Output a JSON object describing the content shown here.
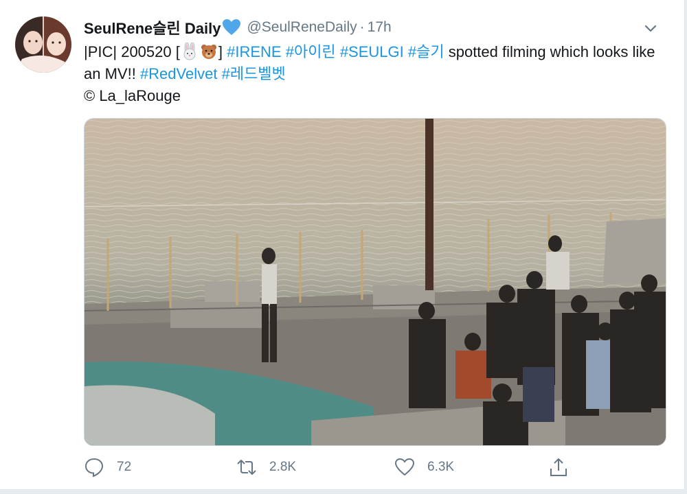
{
  "tweet": {
    "display_name": "SeulRene슬린 Daily",
    "handle": "@SeulReneDaily",
    "separator": "·",
    "time": "17h",
    "text_prefix": "|PIC| 200520 [",
    "text_bracket_close": "]",
    "tags_line1": [
      "#IRENE",
      "#아이린",
      "#SEULGI",
      "#슬기"
    ],
    "text_mid": "spotted filming which looks like an MV!!",
    "tags_line2": [
      "#RedVelvet",
      "#레드벨벳"
    ],
    "credit": "© La_laRouge"
  },
  "actions": {
    "reply_count": "72",
    "retweet_count": "2.8K",
    "like_count": "6.3K"
  },
  "colors": {
    "link": "#1b95e0",
    "muted": "#657786",
    "verified_heart": "#4fa6e8"
  },
  "icons": [
    "avatar",
    "blue-heart-icon",
    "chevron-down-icon",
    "rabbit-emoji-icon",
    "bear-emoji-icon",
    "reply-icon",
    "retweet-icon",
    "like-icon",
    "share-icon"
  ]
}
